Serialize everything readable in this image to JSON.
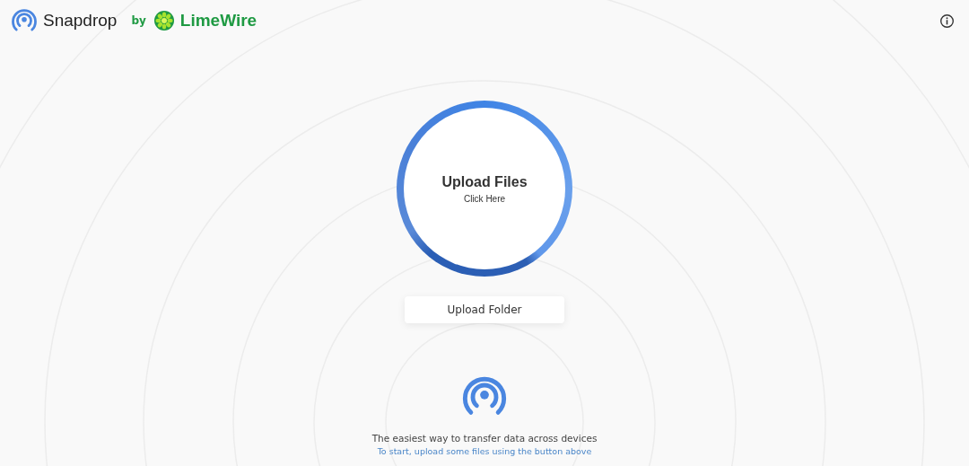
{
  "header": {
    "app_name": "Snapdrop",
    "by": "by",
    "partner": "LimeWire"
  },
  "upload": {
    "title": "Upload Files",
    "subtitle": "Click Here",
    "folder_button": "Upload Folder"
  },
  "footer": {
    "tagline": "The easiest way to transfer data across devices",
    "hint": "To start, upload some files using the button above"
  }
}
